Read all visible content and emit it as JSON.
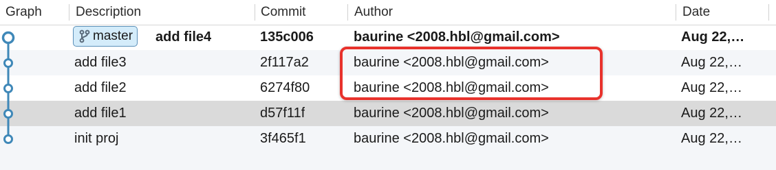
{
  "columns": {
    "graph": "Graph",
    "description": "Description",
    "commit": "Commit",
    "author": "Author",
    "date": "Date"
  },
  "branch": {
    "name": "master",
    "icon": "branch-icon"
  },
  "commits": [
    {
      "description": "add file4",
      "commit": "135c006",
      "author": "baurine <2008.hbl@gmail.com>",
      "date": "Aug 22,…",
      "bold": true
    },
    {
      "description": "add file3",
      "commit": "2f117a2",
      "author": "baurine <2008.hbl@gmail.com>",
      "date": "Aug 22,…"
    },
    {
      "description": "add file2",
      "commit": "6274f80",
      "author": "baurine <2008.hbl@gmail.com>",
      "date": "Aug 22,…"
    },
    {
      "description": "add file1",
      "commit": "d57f11f",
      "author": "baurine <2008.hbl@gmail.com>",
      "date": "Aug 22,…"
    },
    {
      "description": "init proj",
      "commit": "3f465f1",
      "author": "baurine <2008.hbl@gmail.com>",
      "date": "Aug 22,…"
    }
  ],
  "colors": {
    "graph_line": "#3f88b8",
    "highlight_border": "#e8322c",
    "badge_bg": "#d4ecfa",
    "selected_row": "#dadada"
  }
}
